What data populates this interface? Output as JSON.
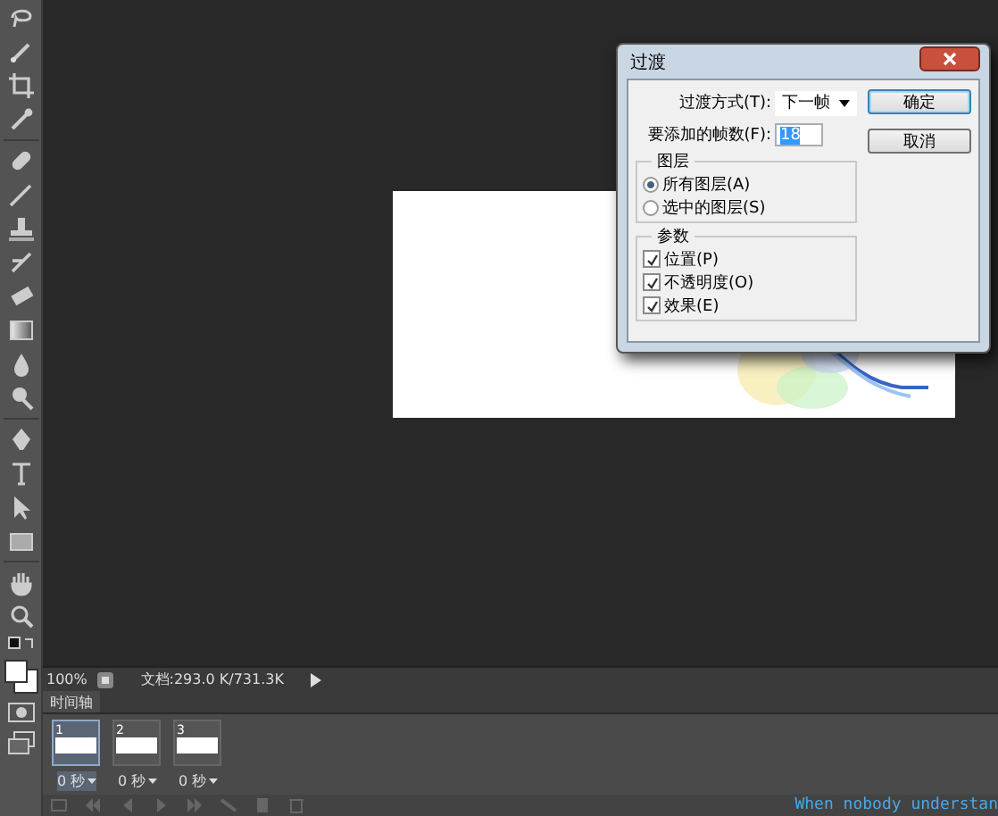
{
  "dialog": {
    "title": "过渡",
    "fields": [
      {
        "kind": "select",
        "label": "过渡方式(T):",
        "value": "下一帧"
      },
      {
        "kind": "number",
        "label": "要添加的帧数(F):",
        "value": "18"
      }
    ],
    "buttons": [
      "确定",
      "取消"
    ],
    "layers": {
      "title": "图层",
      "options": [
        {
          "label": "所有图层(A)",
          "selected": true
        },
        {
          "label": "选中的图层(S)",
          "selected": false
        }
      ]
    },
    "params": {
      "title": "参数",
      "options": [
        {
          "label": "位置(P)",
          "checked": true
        },
        {
          "label": "不透明度(O)",
          "checked": true
        },
        {
          "label": "效果(E)",
          "checked": true
        }
      ]
    }
  },
  "status_bar": {
    "zoom": "100%",
    "document": "文档:293.0 K/731.3K"
  },
  "timeline": {
    "tab": "时间轴",
    "frames": [
      {
        "number": "1",
        "delay": "0 秒",
        "selected": true
      },
      {
        "number": "2",
        "delay": "0 秒",
        "selected": false
      },
      {
        "number": "3",
        "delay": "0 秒",
        "selected": false
      }
    ]
  },
  "caption": "When nobody understan"
}
